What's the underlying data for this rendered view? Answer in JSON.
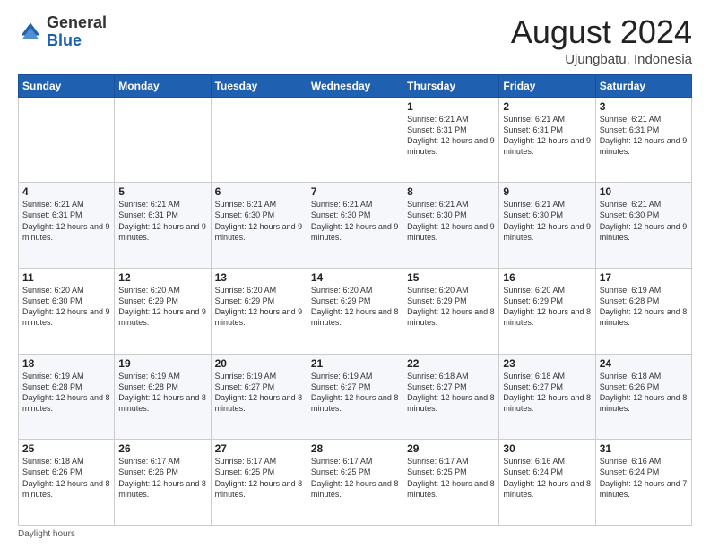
{
  "logo": {
    "line1": "General",
    "line2": "Blue"
  },
  "title": {
    "month_year": "August 2024",
    "location": "Ujungbatu, Indonesia"
  },
  "days_of_week": [
    "Sunday",
    "Monday",
    "Tuesday",
    "Wednesday",
    "Thursday",
    "Friday",
    "Saturday"
  ],
  "footer": {
    "daylight_label": "Daylight hours"
  },
  "weeks": [
    [
      {
        "day": "",
        "info": ""
      },
      {
        "day": "",
        "info": ""
      },
      {
        "day": "",
        "info": ""
      },
      {
        "day": "",
        "info": ""
      },
      {
        "day": "1",
        "info": "Sunrise: 6:21 AM\nSunset: 6:31 PM\nDaylight: 12 hours and 9 minutes."
      },
      {
        "day": "2",
        "info": "Sunrise: 6:21 AM\nSunset: 6:31 PM\nDaylight: 12 hours and 9 minutes."
      },
      {
        "day": "3",
        "info": "Sunrise: 6:21 AM\nSunset: 6:31 PM\nDaylight: 12 hours and 9 minutes."
      }
    ],
    [
      {
        "day": "4",
        "info": "Sunrise: 6:21 AM\nSunset: 6:31 PM\nDaylight: 12 hours and 9 minutes."
      },
      {
        "day": "5",
        "info": "Sunrise: 6:21 AM\nSunset: 6:31 PM\nDaylight: 12 hours and 9 minutes."
      },
      {
        "day": "6",
        "info": "Sunrise: 6:21 AM\nSunset: 6:30 PM\nDaylight: 12 hours and 9 minutes."
      },
      {
        "day": "7",
        "info": "Sunrise: 6:21 AM\nSunset: 6:30 PM\nDaylight: 12 hours and 9 minutes."
      },
      {
        "day": "8",
        "info": "Sunrise: 6:21 AM\nSunset: 6:30 PM\nDaylight: 12 hours and 9 minutes."
      },
      {
        "day": "9",
        "info": "Sunrise: 6:21 AM\nSunset: 6:30 PM\nDaylight: 12 hours and 9 minutes."
      },
      {
        "day": "10",
        "info": "Sunrise: 6:21 AM\nSunset: 6:30 PM\nDaylight: 12 hours and 9 minutes."
      }
    ],
    [
      {
        "day": "11",
        "info": "Sunrise: 6:20 AM\nSunset: 6:30 PM\nDaylight: 12 hours and 9 minutes."
      },
      {
        "day": "12",
        "info": "Sunrise: 6:20 AM\nSunset: 6:29 PM\nDaylight: 12 hours and 9 minutes."
      },
      {
        "day": "13",
        "info": "Sunrise: 6:20 AM\nSunset: 6:29 PM\nDaylight: 12 hours and 9 minutes."
      },
      {
        "day": "14",
        "info": "Sunrise: 6:20 AM\nSunset: 6:29 PM\nDaylight: 12 hours and 8 minutes."
      },
      {
        "day": "15",
        "info": "Sunrise: 6:20 AM\nSunset: 6:29 PM\nDaylight: 12 hours and 8 minutes."
      },
      {
        "day": "16",
        "info": "Sunrise: 6:20 AM\nSunset: 6:29 PM\nDaylight: 12 hours and 8 minutes."
      },
      {
        "day": "17",
        "info": "Sunrise: 6:19 AM\nSunset: 6:28 PM\nDaylight: 12 hours and 8 minutes."
      }
    ],
    [
      {
        "day": "18",
        "info": "Sunrise: 6:19 AM\nSunset: 6:28 PM\nDaylight: 12 hours and 8 minutes."
      },
      {
        "day": "19",
        "info": "Sunrise: 6:19 AM\nSunset: 6:28 PM\nDaylight: 12 hours and 8 minutes."
      },
      {
        "day": "20",
        "info": "Sunrise: 6:19 AM\nSunset: 6:27 PM\nDaylight: 12 hours and 8 minutes."
      },
      {
        "day": "21",
        "info": "Sunrise: 6:19 AM\nSunset: 6:27 PM\nDaylight: 12 hours and 8 minutes."
      },
      {
        "day": "22",
        "info": "Sunrise: 6:18 AM\nSunset: 6:27 PM\nDaylight: 12 hours and 8 minutes."
      },
      {
        "day": "23",
        "info": "Sunrise: 6:18 AM\nSunset: 6:27 PM\nDaylight: 12 hours and 8 minutes."
      },
      {
        "day": "24",
        "info": "Sunrise: 6:18 AM\nSunset: 6:26 PM\nDaylight: 12 hours and 8 minutes."
      }
    ],
    [
      {
        "day": "25",
        "info": "Sunrise: 6:18 AM\nSunset: 6:26 PM\nDaylight: 12 hours and 8 minutes."
      },
      {
        "day": "26",
        "info": "Sunrise: 6:17 AM\nSunset: 6:26 PM\nDaylight: 12 hours and 8 minutes."
      },
      {
        "day": "27",
        "info": "Sunrise: 6:17 AM\nSunset: 6:25 PM\nDaylight: 12 hours and 8 minutes."
      },
      {
        "day": "28",
        "info": "Sunrise: 6:17 AM\nSunset: 6:25 PM\nDaylight: 12 hours and 8 minutes."
      },
      {
        "day": "29",
        "info": "Sunrise: 6:17 AM\nSunset: 6:25 PM\nDaylight: 12 hours and 8 minutes."
      },
      {
        "day": "30",
        "info": "Sunrise: 6:16 AM\nSunset: 6:24 PM\nDaylight: 12 hours and 8 minutes."
      },
      {
        "day": "31",
        "info": "Sunrise: 6:16 AM\nSunset: 6:24 PM\nDaylight: 12 hours and 7 minutes."
      }
    ]
  ]
}
